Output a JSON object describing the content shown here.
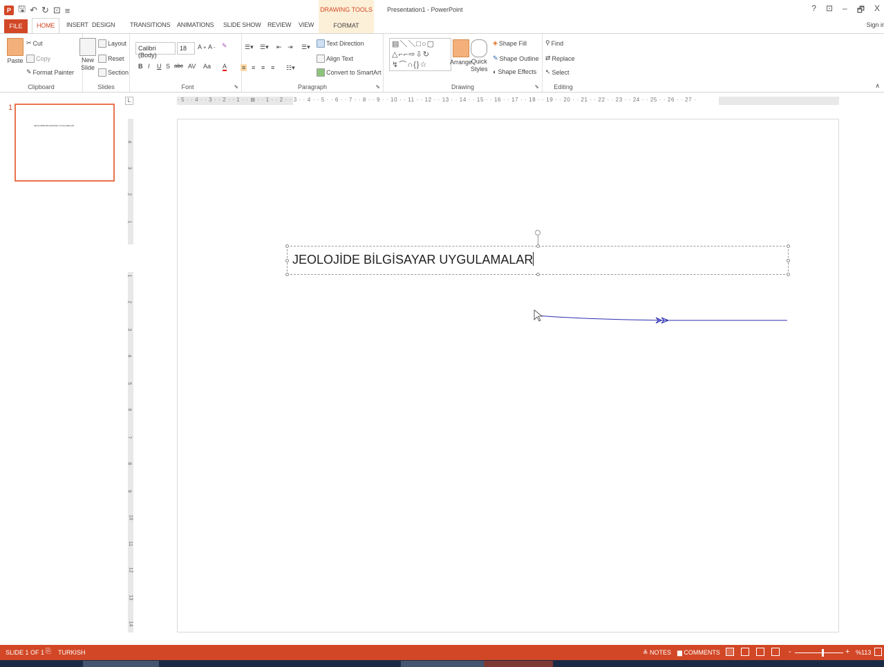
{
  "title_bar": {
    "window_title": "Presentation1 - PowerPoint",
    "contextual_tab_group": "DRAWING TOOLS",
    "controls": [
      "?",
      "⊡",
      "–",
      "🗗",
      "X"
    ]
  },
  "tabs": {
    "file": "FILE",
    "items": [
      "HOME",
      "INSERT",
      "DESIGN",
      "TRANSITIONS",
      "ANIMATIONS",
      "SLIDE SHOW",
      "REVIEW",
      "VIEW"
    ],
    "format": "FORMAT",
    "sign_in": "Sign ir"
  },
  "ribbon": {
    "clipboard": {
      "label": "Clipboard",
      "paste": "Paste",
      "cut": "Cut",
      "copy": "Copy",
      "format_painter": "Format Painter"
    },
    "slides": {
      "label": "Slides",
      "new_slide": "New",
      "new_slide_2": "Slide",
      "layout": "Layout",
      "reset": "Reset",
      "section": "Section"
    },
    "font": {
      "label": "Font",
      "font_name": "Calibri (Body)",
      "font_size": "18",
      "bold": "B",
      "italic": "I",
      "underline": "U",
      "shadow": "S",
      "strike": "abc",
      "spacing": "AV",
      "case": "Aa",
      "color": "A"
    },
    "paragraph": {
      "label": "Paragraph",
      "text_direction": "Text Direction",
      "align_text": "Align Text",
      "convert_smartart": "Convert to SmartArt"
    },
    "drawing": {
      "label": "Drawing",
      "arrange": "Arrange",
      "quick_styles": "Quick",
      "quick_styles_2": "Styles",
      "shape_fill": "Shape Fill",
      "shape_outline": "Shape Outline",
      "shape_effects": "Shape Effects",
      "shapes_gallery": "▤＼＼□○▢ △⌐⌐⇨⇩↻ ↯⌒∩{}☆"
    },
    "editing": {
      "label": "Editing",
      "find": "Find",
      "replace": "Replace",
      "select": "Select"
    }
  },
  "thumbnails": {
    "slide_number": "1",
    "thumb_text": "JEOLOJİDE BİLGİSAYAR UYGULAMALAR"
  },
  "rulers": {
    "corner": "L",
    "h_numbers": "· 5 · · 4 · · 3 · · 2 · · 1 · · ⊠ · · 1 · · 2 · · 3 · · 4 · · 5 · · 6 · · 7 · · 8 · · 9 · · 10 · · 11 · · 12 · · 13 · · 14 · · 15 · · 16 · · 17 · · 18 · · 19 · · 20 · · 21 · · 22 · · 23 · · 24 · · 25 · · 26 · · 27 ·",
    "v_numbers": [
      "4",
      "3",
      "2",
      "1",
      "1",
      "2",
      "3",
      "4",
      "5",
      "6",
      "7",
      "8",
      "9",
      "10",
      "11",
      "12",
      "13",
      "14"
    ]
  },
  "slide": {
    "title_text": "JEOLOJİDE BİLGİSAYAR UYGULAMALAR",
    "annotation_arrow_color": "#2b2bb0"
  },
  "status_bar": {
    "slide_counter": "SLIDE 1 OF 1",
    "language": "TURKISH",
    "notes": "≜ NOTES",
    "comments": "COMMENTS",
    "zoom": "%113",
    "zoom_minus": "-",
    "zoom_plus": "+"
  },
  "colors": {
    "accent": "#d24726",
    "contextual_tab_bg": "#fdf0d8",
    "thumb_border": "#e8734c"
  }
}
